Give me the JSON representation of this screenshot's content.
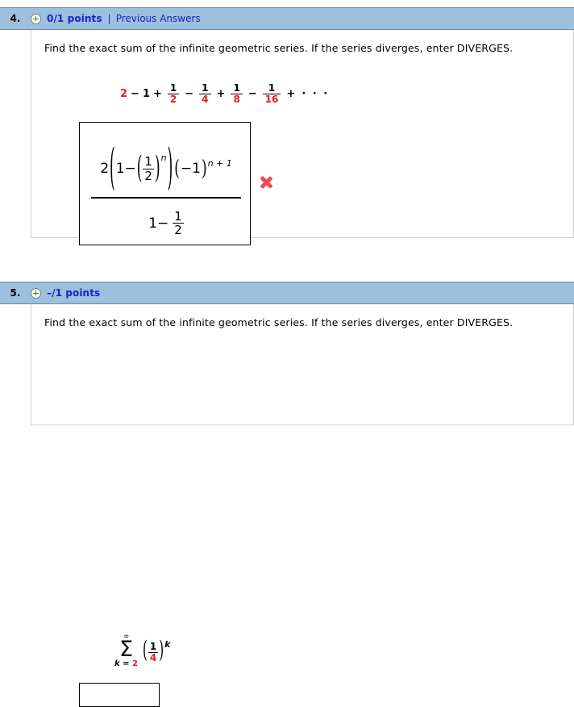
{
  "questions": [
    {
      "number": "4.",
      "points": "0/1 points",
      "separator": "|",
      "previous_answers": "Previous Answers",
      "status_icon": "plus-circle-icon",
      "prompt": "Find the exact sum of the infinite geometric series. If the series diverges, enter DIVERGES.",
      "series": {
        "t1": "2",
        "op1": "−",
        "t2": "1",
        "op2": "+",
        "f1_num": "1",
        "f1_den": "2",
        "op3": "−",
        "f2_num": "1",
        "f2_den": "4",
        "op4": "+",
        "f3_num": "1",
        "f3_den": "8",
        "op5": "−",
        "f4_num": "1",
        "f4_den": "16",
        "op6": "+",
        "dots": "· · ·"
      },
      "answer_expression": {
        "coefficient": "2",
        "one": "1",
        "minus": "−",
        "inner_num": "1",
        "inner_den": "2",
        "inner_exponent": "n",
        "neg_one_open": "(",
        "neg_one_minus": "−",
        "neg_one_value": "1",
        "neg_one_close": ")",
        "neg_one_exponent": "n + 1",
        "denom_one": "1",
        "denom_minus": "−",
        "denom_frac_num": "1",
        "denom_frac_den": "2"
      },
      "result_icon": "incorrect-x-icon",
      "result_color": "#f04a4a"
    },
    {
      "number": "5.",
      "points": "–/1 points",
      "status_icon": "plus-circle-icon",
      "prompt": "Find the exact sum of the infinite geometric series. If the series diverges, enter DIVERGES.",
      "summation": {
        "upper_limit": "∞",
        "sigma": "Σ",
        "lower_index": "k",
        "lower_equals": "=",
        "lower_value": "2",
        "paren_open": "(",
        "frac_num": "1",
        "frac_den": "4",
        "paren_close": ")",
        "exponent": "k"
      },
      "answer_value": "",
      "answer_placeholder": ""
    }
  ],
  "colors": {
    "header_bg": "#9cc0dd",
    "header_border": "#6e87a0",
    "link": "#1a21c8",
    "math_red": "#e01b1b",
    "incorrect": "#f04a4a",
    "body_border": "#cfcfcf"
  }
}
